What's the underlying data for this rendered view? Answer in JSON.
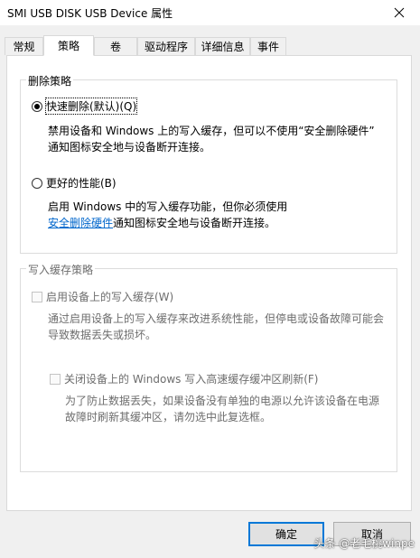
{
  "window": {
    "title": "SMI USB DISK USB Device 属性"
  },
  "tabs": [
    {
      "label": "常规",
      "active": false
    },
    {
      "label": "策略",
      "active": true
    },
    {
      "label": "卷",
      "active": false
    },
    {
      "label": "驱动程序",
      "active": false
    },
    {
      "label": "详细信息",
      "active": false
    },
    {
      "label": "事件",
      "active": false
    }
  ],
  "removal_policy": {
    "title": "删除策略",
    "quick_removal": {
      "label": "快速删除(默认)(Q)",
      "checked": true,
      "desc_line1": "禁用设备和 Windows 上的写入缓存，但可以不使用“安全删除硬件”",
      "desc_line2": "通知图标安全地与设备断开连接。"
    },
    "better_performance": {
      "label": "更好的性能(B)",
      "checked": false,
      "desc_line1": "启用 Windows 中的写入缓存功能，但你必须使用",
      "desc_link": "安全删除硬件",
      "desc_line2_rest": "通知图标安全地与设备断开连接。"
    }
  },
  "write_cache_policy": {
    "title": "写入缓存策略",
    "enable_cache": {
      "label": "启用设备上的写入缓存(W)",
      "checked": false,
      "desc_line1": "通过启用设备上的写入缓存来改进系统性能，但停电或设备故障可能会",
      "desc_line2": "导致数据丢失或损坏。"
    },
    "turn_off_flush": {
      "label": "关闭设备上的 Windows 写入高速缓存缓冲区刷新(F)",
      "checked": false,
      "desc_line1": "为了防止数据丢失，如果设备没有单独的电源以允许该设备在电源",
      "desc_line2": "故障时刷新其缓冲区，请勿选中此复选框。"
    }
  },
  "buttons": {
    "ok": "确定",
    "cancel": "取消"
  },
  "watermark": "头条 @老毛桃winpe",
  "colors": {
    "link": "#0066cc",
    "default_button_border": "#0078d7",
    "disabled_text": "#6d6d6d"
  }
}
